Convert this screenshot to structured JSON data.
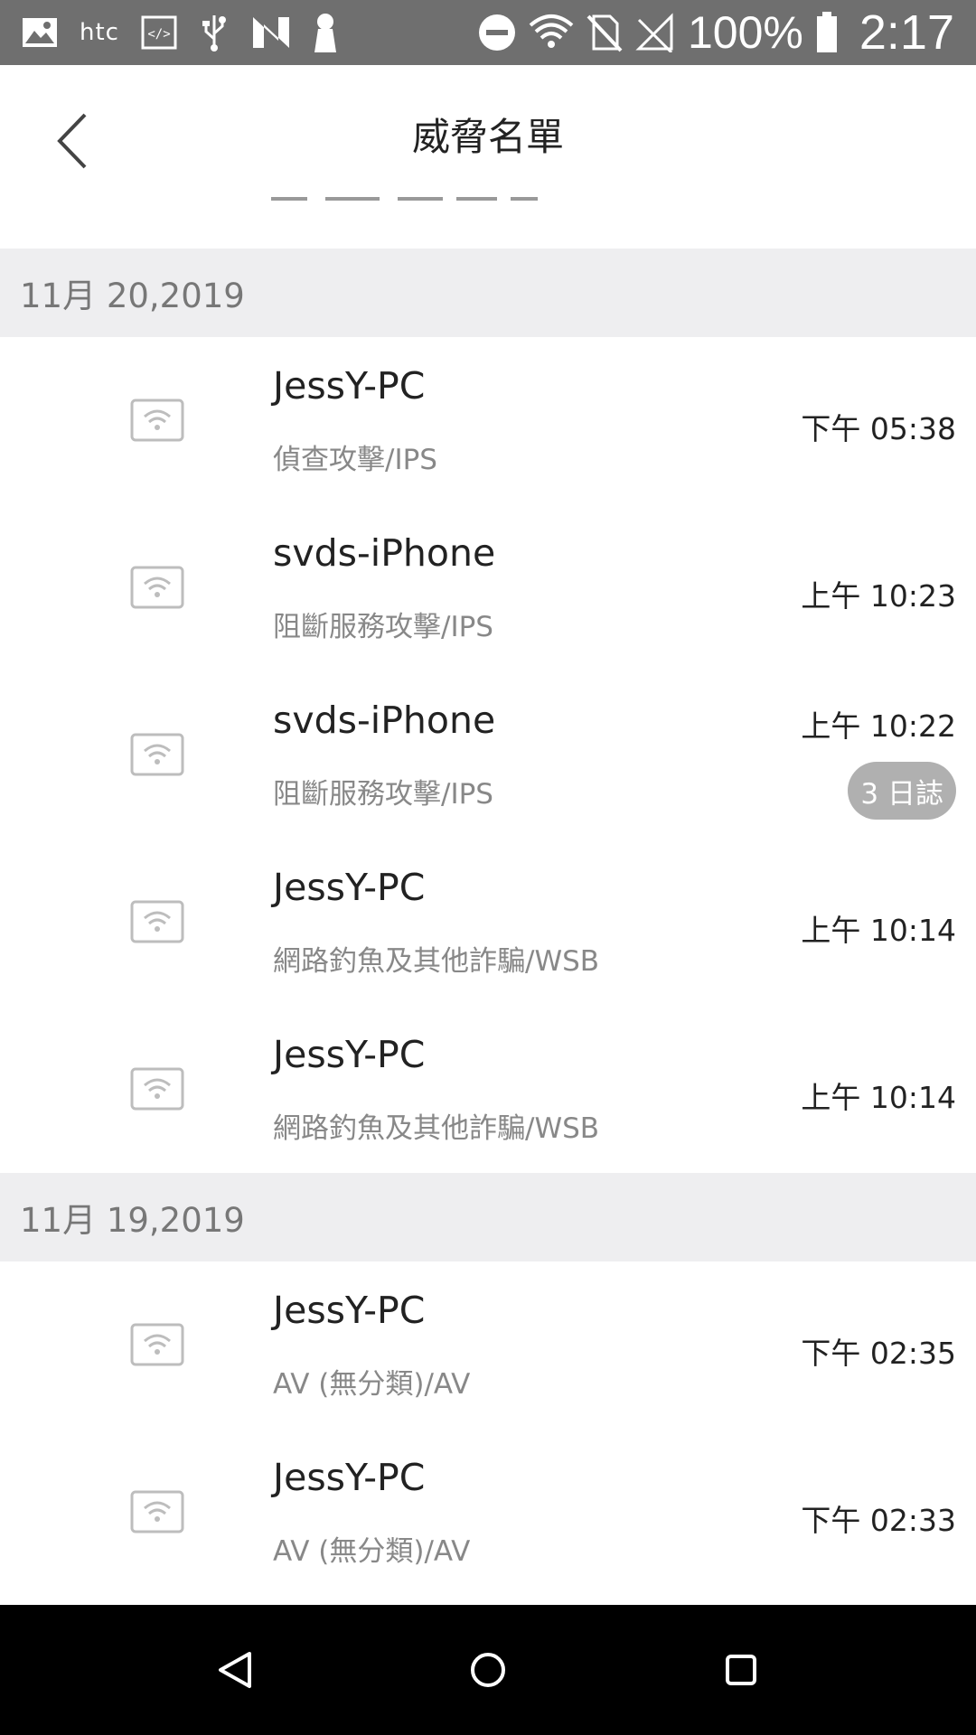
{
  "status_bar": {
    "brand": "htc",
    "battery": "100%",
    "time": "2:17",
    "icons": [
      "image-icon",
      "htc-logo",
      "code-icon",
      "usb-icon",
      "nfc-icon",
      "keyhole-icon",
      "dnd-icon",
      "wifi-icon",
      "no-sim-icon",
      "signal-icon",
      "battery-icon"
    ]
  },
  "header": {
    "title": "威脅名單",
    "back_icon": "chevron-left-icon"
  },
  "sections": [
    {
      "date": "11月 20,2019",
      "items": [
        {
          "device": "JessY-PC",
          "threat": "偵查攻擊/IPS",
          "time": "下午 05:38",
          "badge": ""
        },
        {
          "device": "svds-iPhone",
          "threat": "阻斷服務攻擊/IPS",
          "time": "上午 10:23",
          "badge": ""
        },
        {
          "device": "svds-iPhone",
          "threat": "阻斷服務攻擊/IPS",
          "time": "上午 10:22",
          "badge": "3 日誌"
        },
        {
          "device": "JessY-PC",
          "threat": "網路釣魚及其他詐騙/WSB",
          "time": "上午 10:14",
          "badge": ""
        },
        {
          "device": "JessY-PC",
          "threat": "網路釣魚及其他詐騙/WSB",
          "time": "上午 10:14",
          "badge": ""
        }
      ]
    },
    {
      "date": "11月 19,2019",
      "items": [
        {
          "device": "JessY-PC",
          "threat": "AV (無分類)/AV",
          "time": "下午 02:35",
          "badge": ""
        },
        {
          "device": "JessY-PC",
          "threat": "AV (無分類)/AV",
          "time": "下午 02:33",
          "badge": ""
        }
      ]
    }
  ],
  "nav_bar": {
    "icons": [
      "back-triangle-icon",
      "home-circle-icon",
      "recents-square-icon"
    ]
  },
  "colors": {
    "status_bar_bg": "#6f6f6f",
    "section_bg": "#eeeef0",
    "badge_bg": "#b0b0b0",
    "nav_bg": "#000000"
  }
}
